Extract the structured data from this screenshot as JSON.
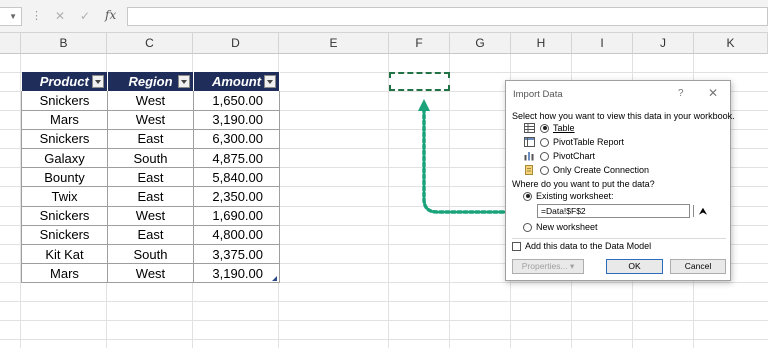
{
  "formula_bar": {
    "fx_label": "fx",
    "cancel_icon": "close-icon",
    "enter_icon": "check-icon",
    "value": ""
  },
  "columns": [
    "B",
    "C",
    "D",
    "E",
    "F",
    "G",
    "H",
    "I",
    "J",
    "K"
  ],
  "table": {
    "headers": [
      "Product",
      "Region",
      "Amount"
    ],
    "rows": [
      [
        "Snickers",
        "West",
        "1,650.00"
      ],
      [
        "Mars",
        "West",
        "3,190.00"
      ],
      [
        "Snickers",
        "East",
        "6,300.00"
      ],
      [
        "Galaxy",
        "South",
        "4,875.00"
      ],
      [
        "Bounty",
        "East",
        "5,840.00"
      ],
      [
        "Twix",
        "East",
        "2,350.00"
      ],
      [
        "Snickers",
        "West",
        "1,690.00"
      ],
      [
        "Snickers",
        "East",
        "4,800.00"
      ],
      [
        "Kit Kat",
        "South",
        "3,375.00"
      ],
      [
        "Mars",
        "West",
        "3,190.00"
      ]
    ]
  },
  "dialog": {
    "title": "Import Data",
    "help": "?",
    "close": "✕",
    "view_prompt": "Select how you want to view this data in your workbook.",
    "view_options": [
      {
        "label": "Table",
        "selected": true,
        "icon": "table-icon"
      },
      {
        "label": "PivotTable Report",
        "selected": false,
        "icon": "pivottable-icon"
      },
      {
        "label": "PivotChart",
        "selected": false,
        "icon": "pivotchart-icon"
      },
      {
        "label": "Only Create Connection",
        "selected": false,
        "icon": "connection-icon"
      }
    ],
    "put_prompt": "Where do you want to put the data?",
    "existing_label": "Existing worksheet:",
    "reference": "=Data!$F$2",
    "new_label": "New worksheet",
    "model_label": "Add this data to the Data Model",
    "properties_label": "Properties...",
    "ok_label": "OK",
    "cancel_label": "Cancel"
  },
  "colors": {
    "header_bg": "#1f2d5a",
    "selection": "#217346",
    "arrow": "#1aa37a"
  }
}
